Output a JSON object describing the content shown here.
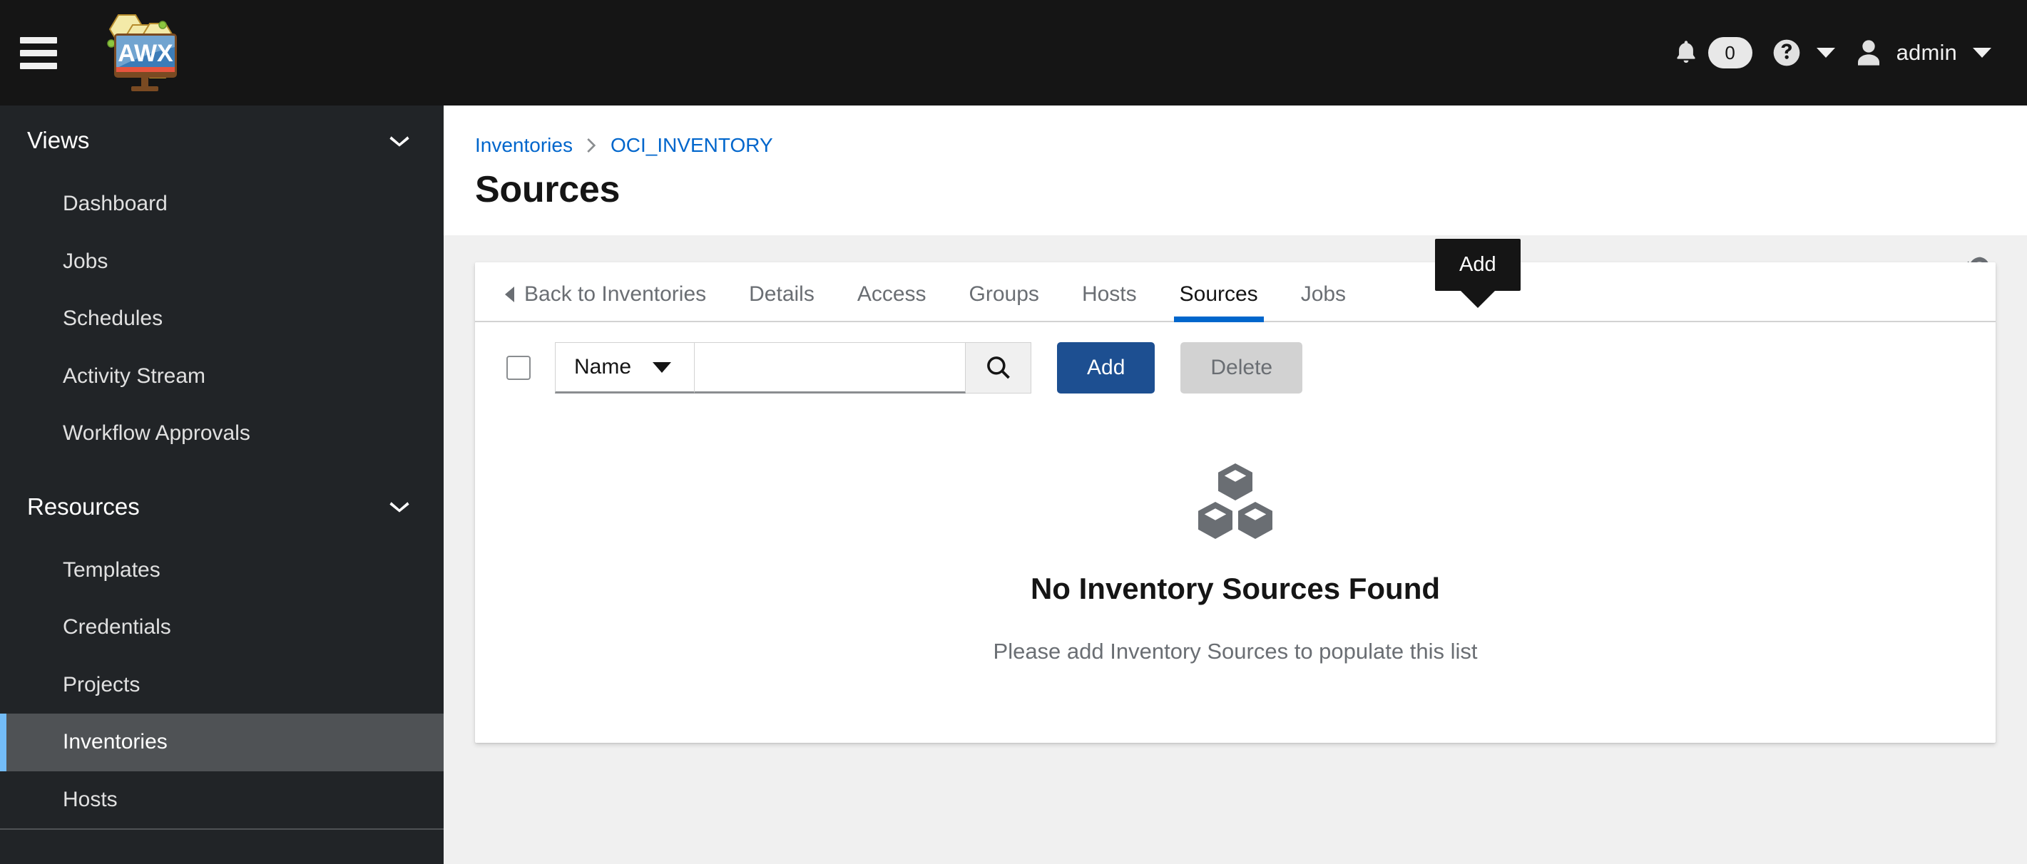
{
  "masthead": {
    "menu_icon": "hamburger-icon",
    "logo_text": "AWX",
    "notifications": {
      "icon": "bell-icon",
      "count": "0"
    },
    "help": {
      "icon": "question-circle-icon",
      "caret": "caret-down-icon"
    },
    "user": {
      "icon": "user-icon",
      "name": "admin",
      "caret": "caret-down-icon"
    }
  },
  "sidebar": {
    "sections": [
      {
        "label": "Views",
        "expanded": true,
        "items": [
          {
            "label": "Dashboard",
            "active": false
          },
          {
            "label": "Jobs",
            "active": false
          },
          {
            "label": "Schedules",
            "active": false
          },
          {
            "label": "Activity Stream",
            "active": false
          },
          {
            "label": "Workflow Approvals",
            "active": false
          }
        ]
      },
      {
        "label": "Resources",
        "expanded": true,
        "items": [
          {
            "label": "Templates",
            "active": false
          },
          {
            "label": "Credentials",
            "active": false
          },
          {
            "label": "Projects",
            "active": false
          },
          {
            "label": "Inventories",
            "active": true
          },
          {
            "label": "Hosts",
            "active": false
          }
        ]
      }
    ]
  },
  "page": {
    "breadcrumb": [
      {
        "label": "Inventories",
        "link": true
      },
      {
        "label": "OCI_INVENTORY",
        "link": true
      }
    ],
    "title": "Sources",
    "history_icon": "history-icon"
  },
  "tabs": [
    {
      "label": "Back to Inventories",
      "active": false,
      "back": true
    },
    {
      "label": "Details",
      "active": false
    },
    {
      "label": "Access",
      "active": false
    },
    {
      "label": "Groups",
      "active": false
    },
    {
      "label": "Hosts",
      "active": false
    },
    {
      "label": "Sources",
      "active": true
    },
    {
      "label": "Jobs",
      "active": false
    }
  ],
  "toolbar": {
    "select_all_checkbox": "unchecked",
    "filter_field": "Name",
    "search_value": "",
    "search_placeholder": "",
    "search_icon": "search-icon",
    "add_label": "Add",
    "delete_label": "Delete",
    "delete_disabled": true
  },
  "tooltip": {
    "text": "Add",
    "visible": true
  },
  "empty_state": {
    "icon": "cubes-icon",
    "title": "No Inventory Sources Found",
    "body": "Please add Inventory Sources to populate this list"
  },
  "colors": {
    "masthead_bg": "#151515",
    "sidebar_bg": "#212427",
    "sidebar_active_bg": "#4f5255",
    "sidebar_active_accent": "#73bcf7",
    "link_blue": "#0066cc",
    "primary_button": "#1d4f91",
    "tab_active_underline": "#0066cc",
    "page_bg": "#f0f0f0",
    "muted_text": "#6a6e73"
  }
}
